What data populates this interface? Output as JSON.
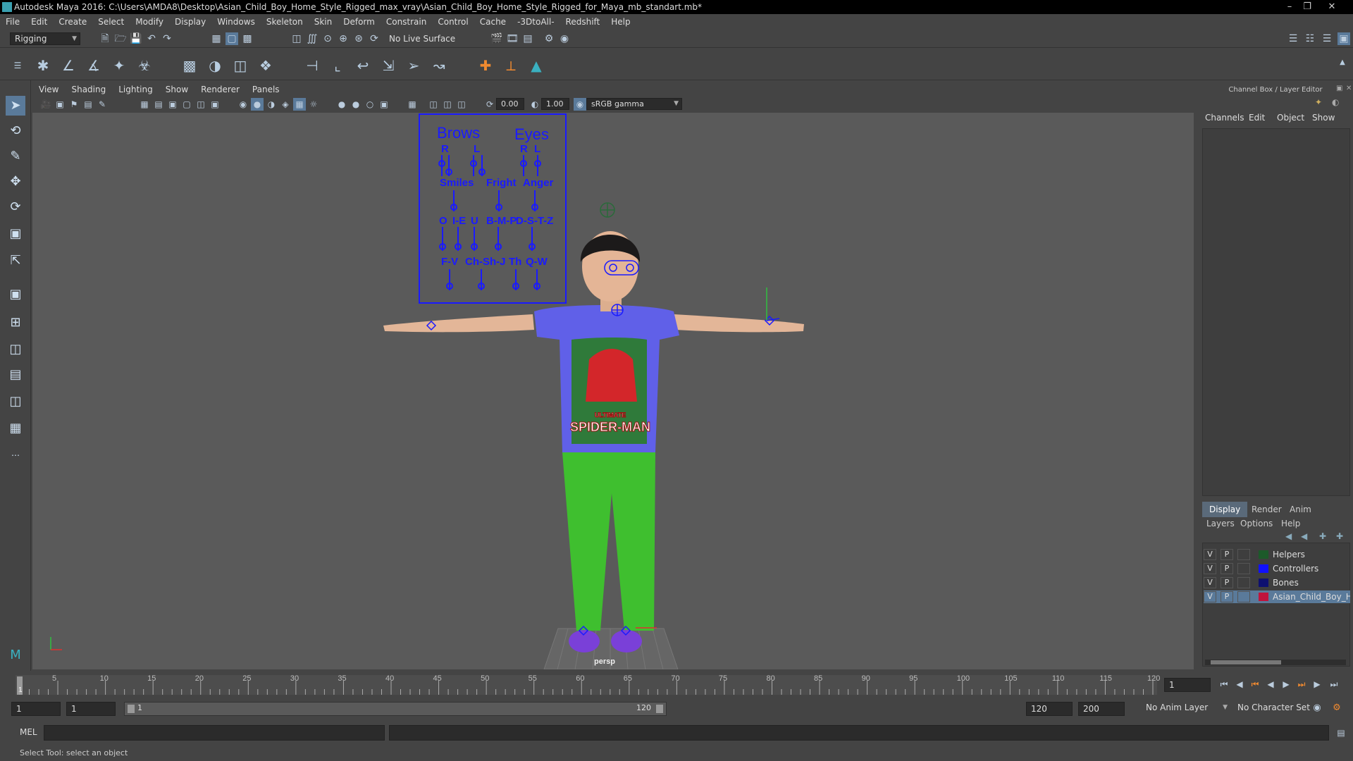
{
  "app": {
    "title": "Autodesk Maya 2016: C:\\Users\\AMDA8\\Desktop\\Asian_Child_Boy_Home_Style_Rigged_max_vray\\Asian_Child_Boy_Home_Style_Rigged_for_Maya_mb_standart.mb*"
  },
  "menus": [
    "File",
    "Edit",
    "Create",
    "Select",
    "Modify",
    "Display",
    "Windows",
    "Skeleton",
    "Skin",
    "Deform",
    "Constrain",
    "Control",
    "Cache",
    "-3DtoAll-",
    "Redshift",
    "Help"
  ],
  "status": {
    "mode": "Rigging",
    "live_surface": "No Live Surface"
  },
  "panel": {
    "menus": [
      "View",
      "Shading",
      "Lighting",
      "Show",
      "Renderer",
      "Panels"
    ],
    "exposure": "0.00",
    "gamma": "1.00",
    "colorspace": "sRGB gamma",
    "camera": "persp"
  },
  "facial": {
    "brows": "Brows",
    "eyes": "Eyes",
    "r1": "R",
    "l1": "L",
    "r2": "R",
    "l2": "L",
    "smiles": "Smiles",
    "fright": "Fright",
    "anger": "Anger",
    "o": "O",
    "he": "I-E",
    "u": "U",
    "bmp": "B-M-P",
    "dstz": "D-S-T-Z",
    "fv": "F-V",
    "chshj": "Ch-Sh-J",
    "th": "Th",
    "qw": "Q-W"
  },
  "shirt": {
    "line1": "ULTIMATE",
    "line2": "SPIDER-MAN"
  },
  "channelbox": {
    "title": "Channel Box / Layer Editor",
    "tabs": [
      "Channels",
      "Edit",
      "Object",
      "Show"
    ]
  },
  "layers": {
    "tabs": [
      "Display",
      "Render",
      "Anim"
    ],
    "menus": [
      "Layers",
      "Options",
      "Help"
    ],
    "rows": [
      {
        "v": "V",
        "p": "P",
        "name": "Helpers",
        "color": "#1c5a2a"
      },
      {
        "v": "V",
        "p": "P",
        "name": "Controllers",
        "color": "#1010ff"
      },
      {
        "v": "V",
        "p": "P",
        "name": "Bones",
        "color": "#0e1070"
      },
      {
        "v": "V",
        "p": "P",
        "name": "Asian_Child_Boy_Hom",
        "color": "#c0143c"
      }
    ]
  },
  "timeline": {
    "ticks": [
      "5",
      "10",
      "15",
      "20",
      "25",
      "30",
      "35",
      "40",
      "45",
      "50",
      "55",
      "60",
      "65",
      "70",
      "75",
      "80",
      "85",
      "90",
      "95",
      "100",
      "105",
      "110",
      "115",
      "120"
    ],
    "start_label": "1",
    "current_frame": "1"
  },
  "range": {
    "start": "1",
    "playback_start": "1",
    "range_start_label": "1",
    "range_end_label": "120",
    "playback_end": "120",
    "end": "200",
    "anim_layer": "No Anim Layer",
    "char_set": "No Character Set"
  },
  "cmd": {
    "lang": "MEL"
  },
  "help": {
    "text": "Select Tool: select an object"
  }
}
